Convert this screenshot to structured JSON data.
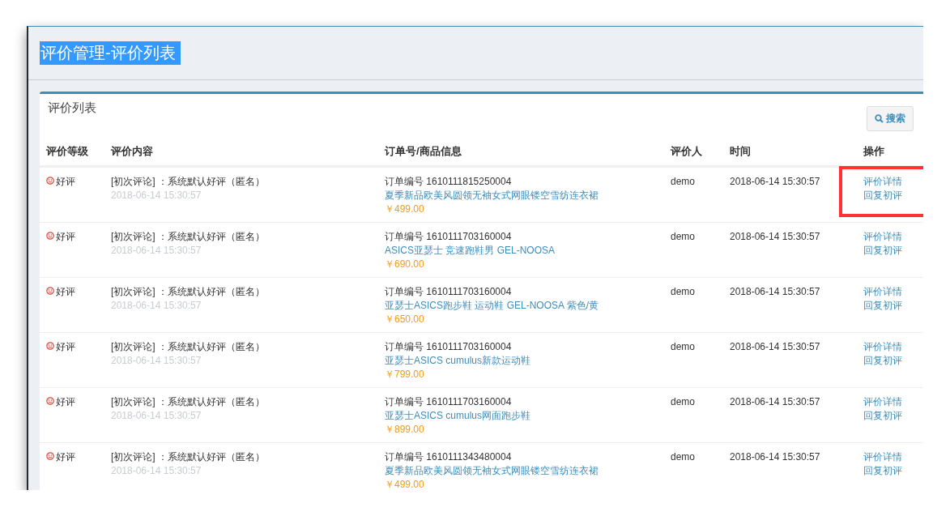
{
  "page_header": {
    "title": "评价管理-评价列表",
    "selected": true
  },
  "panel": {
    "title": "评价列表",
    "search_button": "搜索"
  },
  "table": {
    "columns": [
      "评价等级",
      "评价内容",
      "订单号/商品信息",
      "评价人",
      "时间",
      "操作"
    ],
    "rows": [
      {
        "rating": "好评",
        "comment": "[初次评论] ：系统默认好评（匿名）",
        "comment_time": "2018-06-14 15:30:57",
        "order_no": "订单编号 1610111815250004",
        "product": "夏季新品欧美风圆领无袖女式网眼镂空雪纺连衣裙",
        "price": "￥499.00",
        "reviewer": "demo",
        "time": "2018-06-14 15:30:57",
        "actions": [
          "评价详情",
          "回复初评"
        ],
        "highlighted": true
      },
      {
        "rating": "好评",
        "comment": "[初次评论] ：系统默认好评（匿名）",
        "comment_time": "2018-06-14 15:30:57",
        "order_no": "订单编号 1610111703160004",
        "product": "ASICS亚瑟士 竞速跑鞋男 GEL-NOOSA",
        "price": "￥690.00",
        "reviewer": "demo",
        "time": "2018-06-14 15:30:57",
        "actions": [
          "评价详情",
          "回复初评"
        ],
        "highlighted": false
      },
      {
        "rating": "好评",
        "comment": "[初次评论] ：系统默认好评（匿名）",
        "comment_time": "2018-06-14 15:30:57",
        "order_no": "订单编号 1610111703160004",
        "product": "亚瑟士ASICS跑步鞋 运动鞋 GEL-NOOSA 紫色/黄",
        "price": "￥650.00",
        "reviewer": "demo",
        "time": "2018-06-14 15:30:57",
        "actions": [
          "评价详情",
          "回复初评"
        ],
        "highlighted": false
      },
      {
        "rating": "好评",
        "comment": "[初次评论] ：系统默认好评（匿名）",
        "comment_time": "2018-06-14 15:30:57",
        "order_no": "订单编号 1610111703160004",
        "product": "亚瑟士ASICS cumulus新款运动鞋",
        "price": "￥799.00",
        "reviewer": "demo",
        "time": "2018-06-14 15:30:57",
        "actions": [
          "评价详情",
          "回复初评"
        ],
        "highlighted": false
      },
      {
        "rating": "好评",
        "comment": "[初次评论] ：系统默认好评（匿名）",
        "comment_time": "2018-06-14 15:30:57",
        "order_no": "订单编号 1610111703160004",
        "product": "亚瑟士ASICS cumulus网面跑步鞋",
        "price": "￥899.00",
        "reviewer": "demo",
        "time": "2018-06-14 15:30:57",
        "actions": [
          "评价详情",
          "回复初评"
        ],
        "highlighted": false
      },
      {
        "rating": "好评",
        "comment": "[初次评论] ：系统默认好评（匿名）",
        "comment_time": "2018-06-14 15:30:57",
        "order_no": "订单编号 1610111343480004",
        "product": "夏季新品欧美风圆领无袖女式网眼镂空雪纺连衣裙",
        "price": "￥499.00",
        "reviewer": "demo",
        "time": "2018-06-14 15:30:57",
        "actions": [
          "评价详情",
          "回复初评"
        ],
        "highlighted": false
      }
    ]
  }
}
